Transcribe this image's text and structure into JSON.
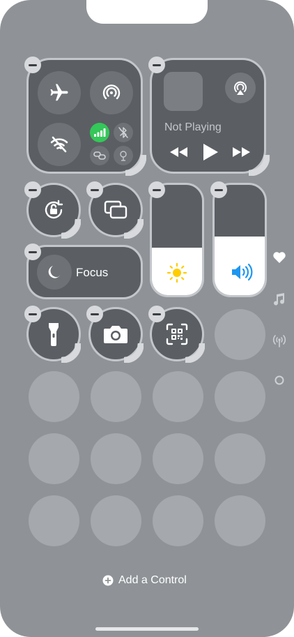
{
  "media": {
    "status": "Not Playing"
  },
  "focus": {
    "label": "Focus"
  },
  "sliders": {
    "brightness_level": 0.43,
    "volume_level": 0.53
  },
  "footer": {
    "add_control_label": "Add a Control"
  },
  "colors": {
    "background": "#8f9397",
    "tile": "#5b5f64",
    "tile_border": "#c3c7cb",
    "cellular_active": "#34c759",
    "brightness_accent": "#ffcc00",
    "volume_accent": "#1e96f0"
  },
  "icons": {
    "connectivity": [
      "airplane-icon",
      "airdrop-icon",
      "wifi-off-icon",
      "cellular-icon",
      "bluetooth-off-icon",
      "personal-hotspot-icon",
      "satellite-icon"
    ],
    "media": [
      "airplay-icon",
      "rewind-icon",
      "play-icon",
      "fast-forward-icon"
    ],
    "controls": [
      "orientation-lock-icon",
      "screen-mirroring-icon",
      "moon-icon",
      "sun-icon",
      "speaker-icon",
      "flashlight-icon",
      "camera-icon",
      "qr-code-icon"
    ],
    "side_nav": [
      "heart-icon",
      "music-note-icon",
      "antenna-icon",
      "ring-icon"
    ],
    "footer": "plus-circle-icon"
  }
}
